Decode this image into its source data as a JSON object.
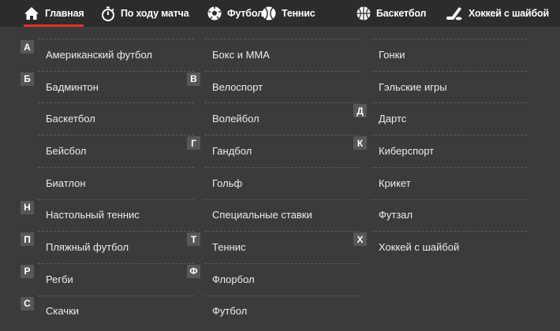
{
  "nav": [
    {
      "label": "Главная",
      "icon": "home-icon",
      "active": true
    },
    {
      "label": "По ходу матча",
      "icon": "stopwatch-icon",
      "active": false
    },
    {
      "label": "Футбол",
      "icon": "soccer-ball-icon",
      "active": false
    },
    {
      "label": "Теннис",
      "icon": "tennis-ball-icon",
      "active": false
    },
    {
      "label": "Баскетбол",
      "icon": "basketball-icon",
      "active": false
    },
    {
      "label": "Хоккей с шайбой",
      "icon": "hockey-stick-icon",
      "active": false
    }
  ],
  "colors": {
    "active_underline": "#e2342b",
    "topbar_bg": "#2c2c2c",
    "page_bg": "#3b3b3b",
    "letter_badge_bg": "#575757"
  },
  "sports_columns": [
    [
      {
        "letter": "А",
        "name": "Американский футбол"
      },
      {
        "letter": "Б",
        "name": "Бадминтон"
      },
      {
        "letter": "",
        "name": "Баскетбол"
      },
      {
        "letter": "",
        "name": "Бейсбол"
      },
      {
        "letter": "",
        "name": "Биатлон"
      },
      {
        "letter": "Н",
        "name": "Настольный теннис"
      },
      {
        "letter": "П",
        "name": "Пляжный футбол"
      },
      {
        "letter": "Р",
        "name": "Регби"
      },
      {
        "letter": "С",
        "name": "Скачки"
      }
    ],
    [
      {
        "letter": "",
        "name": "Бокс и ММА"
      },
      {
        "letter": "В",
        "name": "Велоспорт"
      },
      {
        "letter": "",
        "name": "Волейбол"
      },
      {
        "letter": "Г",
        "name": "Гандбол"
      },
      {
        "letter": "",
        "name": "Гольф"
      },
      {
        "letter": "",
        "name": "Специальные ставки"
      },
      {
        "letter": "Т",
        "name": "Теннис"
      },
      {
        "letter": "Ф",
        "name": "Флорбол"
      },
      {
        "letter": "",
        "name": "Футбол"
      }
    ],
    [
      {
        "letter": "",
        "name": "Гонки"
      },
      {
        "letter": "",
        "name": "Гэльские игры"
      },
      {
        "letter": "Д",
        "name": "Дартс"
      },
      {
        "letter": "К",
        "name": "Киберспорт"
      },
      {
        "letter": "",
        "name": "Крикет"
      },
      {
        "letter": "",
        "name": "Футзал"
      },
      {
        "letter": "Х",
        "name": "Хоккей с шайбой"
      }
    ]
  ]
}
